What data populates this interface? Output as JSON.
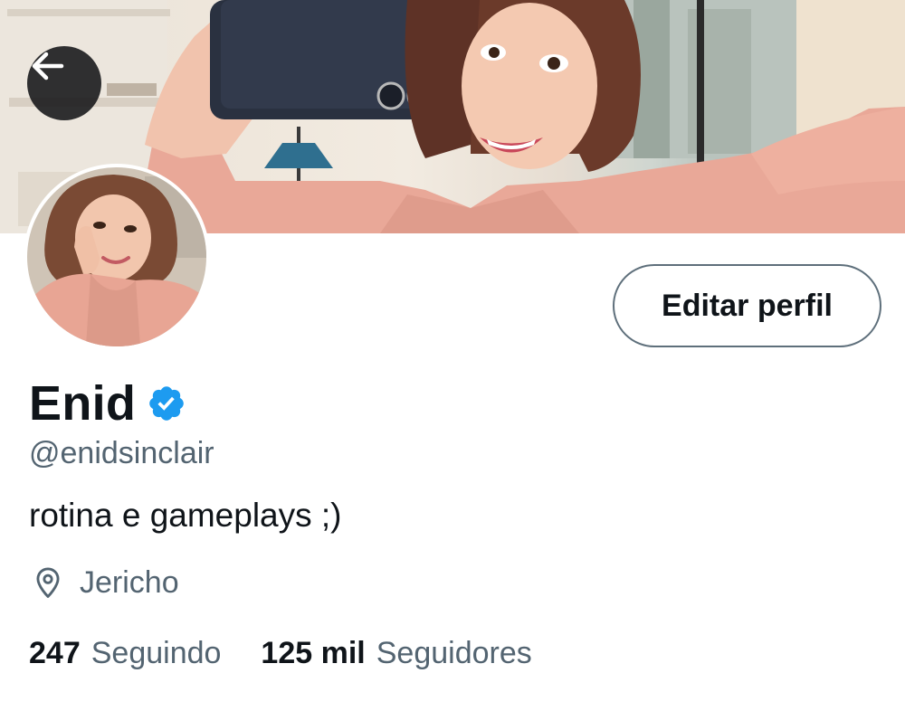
{
  "header": {
    "back_icon": "arrow-left-icon",
    "banner_alt": "selfie-banner-photo"
  },
  "profile": {
    "display_name": "Enid",
    "verified_icon": "verified-badge-icon",
    "handle": "@enidsinclair",
    "bio": "rotina e gameplays ;)",
    "location_icon": "map-pin-icon",
    "location": "Jericho",
    "avatar_alt": "profile-avatar-photo"
  },
  "actions": {
    "edit_label": "Editar perfil"
  },
  "stats": {
    "following_count": "247",
    "following_label": "Seguindo",
    "followers_count": "125 mil",
    "followers_label": "Seguidores"
  },
  "colors": {
    "text_primary": "#0f1419",
    "text_secondary": "#536471",
    "verified_blue": "#1d9bf0",
    "button_border": "#5e6f7b",
    "back_button_bg": "#141618"
  }
}
